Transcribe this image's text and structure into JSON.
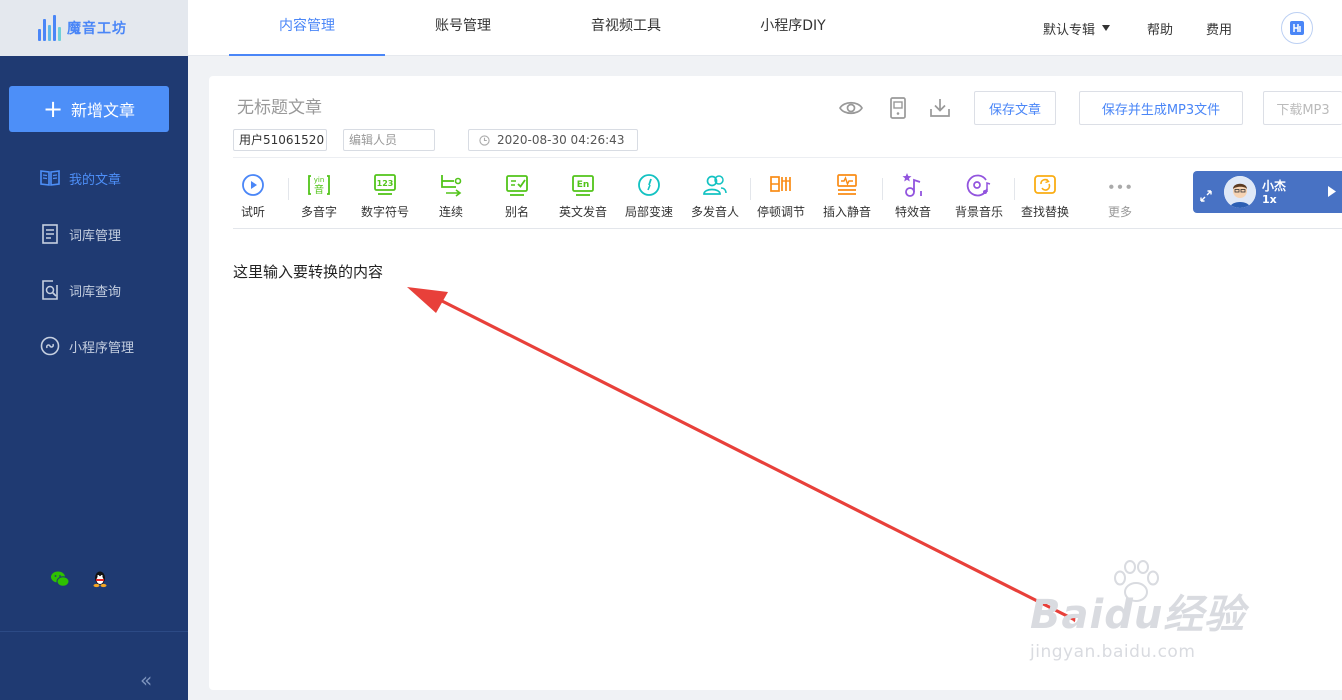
{
  "app": {
    "logo_text": "魔音工坊"
  },
  "sidebar": {
    "new_button": "新增文章",
    "items": [
      {
        "label": "我的文章",
        "icon": "book-icon",
        "active": true
      },
      {
        "label": "词库管理",
        "icon": "document-icon",
        "active": false
      },
      {
        "label": "词库查询",
        "icon": "search-doc-icon",
        "active": false
      },
      {
        "label": "小程序管理",
        "icon": "mini-program-icon",
        "active": false
      }
    ],
    "collapse_symbol": "«"
  },
  "topbar": {
    "tabs": [
      {
        "label": "内容管理",
        "active": true
      },
      {
        "label": "账号管理",
        "active": false
      },
      {
        "label": "音视频工具",
        "active": false
      },
      {
        "label": "小程序DIY",
        "active": false
      }
    ],
    "album_select": "默认专辑",
    "help": "帮助",
    "fees": "费用"
  },
  "editor": {
    "title": "无标题文章",
    "author_value": "用户51061520",
    "editor_placeholder": "编辑人员",
    "datetime": "2020-08-30 04:26:43",
    "save_button": "保存文章",
    "save_mp3_button": "保存并生成MP3文件",
    "download_mp3_button": "下载MP3",
    "content": "这里输入要转换的内容"
  },
  "toolbar": [
    {
      "label": "试听",
      "icon": "play-icon",
      "color": "#4a86f7"
    },
    {
      "label": "多音字",
      "icon": "polyphone-icon",
      "color": "#52c41a"
    },
    {
      "label": "数字符号",
      "icon": "number-icon",
      "color": "#52c41a"
    },
    {
      "label": "连续",
      "icon": "continuous-icon",
      "color": "#52c41a"
    },
    {
      "label": "别名",
      "icon": "alias-icon",
      "color": "#52c41a"
    },
    {
      "label": "英文发音",
      "icon": "english-icon",
      "color": "#52c41a"
    },
    {
      "label": "局部变速",
      "icon": "speed-icon",
      "color": "#13c2c2"
    },
    {
      "label": "多发音人",
      "icon": "multi-speaker-icon",
      "color": "#13c2c2"
    },
    {
      "label": "停顿调节",
      "icon": "pause-icon",
      "color": "#fa8c16"
    },
    {
      "label": "插入静音",
      "icon": "silence-icon",
      "color": "#fa8c16"
    },
    {
      "label": "特效音",
      "icon": "effect-icon",
      "color": "#9254de"
    },
    {
      "label": "背景音乐",
      "icon": "bg-music-icon",
      "color": "#9254de"
    },
    {
      "label": "查找替换",
      "icon": "find-replace-icon",
      "color": "#faad14"
    },
    {
      "label": "更多",
      "icon": "more-icon",
      "color": "#aaaaaa"
    }
  ],
  "voice": {
    "name": "小杰",
    "speed": "1x"
  },
  "watermark": {
    "brand": "Baidu经验",
    "url": "jingyan.baidu.com"
  }
}
